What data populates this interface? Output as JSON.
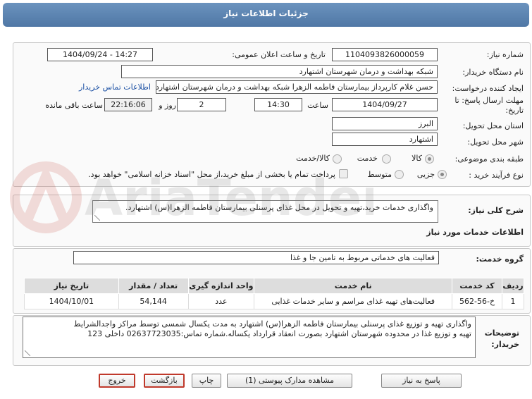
{
  "header": {
    "title": "جزئیات اطلاعات نیاز"
  },
  "fields": {
    "need_number_label": "شماره نیاز:",
    "need_number": "1104093826000059",
    "announce_label": "تاریخ و ساعت اعلان عمومی:",
    "announce_value": "1404/09/24 - 14:27",
    "buyer_org_label": "نام دستگاه خریدار:",
    "buyer_org": "شبکه بهداشت و درمان شهرستان اشتهارد",
    "creator_label": "ایجاد کننده درخواست:",
    "creator": "حسن غلام کارپرداز بیمارستان فاطمه الزهرا شبکه بهداشت و درمان شهرستان اشتهارد",
    "contact_link": "اطلاعات تماس خریدار",
    "deadline_label_1": "مهلت ارسال پاسخ: تا",
    "deadline_label_2": "تاریخ:",
    "deadline_date": "1404/09/27",
    "time_label": "ساعت",
    "deadline_time": "14:30",
    "days_value": "2",
    "days_label": "روز و",
    "remaining_time": "22:16:06",
    "remaining_label": "ساعت باقی مانده",
    "province_label": "استان محل تحویل:",
    "province": "البرز",
    "city_label": "شهر محل تحویل:",
    "city": "اشتهارد",
    "category_label": "طبقه بندی موضوعی:",
    "category_options": [
      "کالا",
      "خدمت",
      "کالا/خدمت"
    ],
    "process_label": "نوع فرآیند خرید :",
    "process_options": [
      "جزیی",
      "متوسط"
    ],
    "treasury_note": "پرداخت تمام یا بخشی از مبلغ خرید،از محل \"اسناد خزانه اسلامی\" خواهد بود."
  },
  "summary": {
    "label": "شرح کلی نیاز:",
    "text": "واگذاری خدمات خرید،تهیه و تحویل در محل غذای پرسنلی بیمارستان فاطمه الزهرا(س) اشتهارد."
  },
  "services": {
    "section_title": "اطلاعات خدمات مورد نیاز",
    "group_label": "گروه خدمت:",
    "group_value": "فعالیت های خدماتی مربوط به تامین جا و غذا",
    "columns": [
      "ردیف",
      "کد خدمت",
      "نام خدمت",
      "واحد اندازه گیری",
      "تعداد / مقدار",
      "تاریخ نیاز"
    ],
    "rows": [
      {
        "row": "1",
        "code": "خ-56-562",
        "name": "فعالیت‌های تهیه غذای مراسم و سایر خدمات غذایی",
        "unit": "عدد",
        "qty": "54,144",
        "date": "1404/10/01"
      }
    ]
  },
  "buyer_notes": {
    "label_1": "توضیحات",
    "label_2": "خریدار:",
    "line_1": "واگذاری تهیه و توزیع غذای پرسنلی بیمارستان فاطمه الزهرا(س) اشتهارد به مدت یکسال شمسی توسط مراکز واجدالشرایط",
    "line_2": "تهیه و توزیع غذا در محدوده شهرستان اشتهارد بصورت انعقاد قرارداد یکساله.شماره تماس:02637723035 داخلی 123"
  },
  "buttons": {
    "reply": "پاسخ به نیاز",
    "attachments": "مشاهده مدارک پیوستی (1)",
    "print": "چاپ",
    "back": "بازگشت",
    "exit": "خروج"
  },
  "watermark": {
    "text": "AriaTender.net"
  }
}
